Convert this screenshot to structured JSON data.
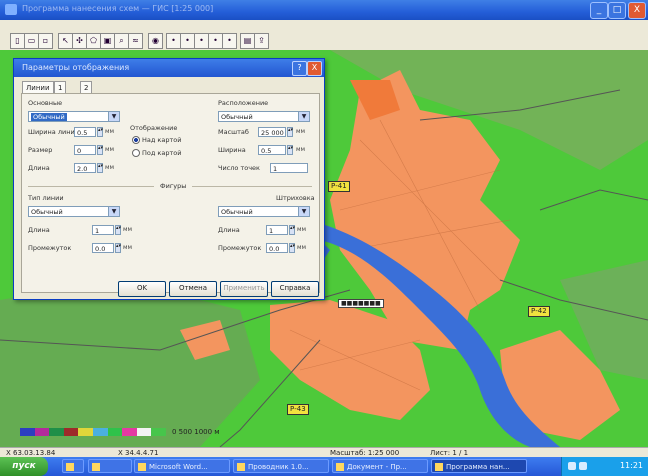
{
  "window": {
    "title": "Программа нанесения схем — ГИС [1:25 000]",
    "buttons": [
      "_",
      "□",
      "X"
    ]
  },
  "toolbar": {
    "tools": [
      "new-file",
      "open-file",
      "save-file",
      "pointer",
      "node-edit",
      "polygon",
      "rectangle",
      "magnify",
      "measure",
      "globe",
      "point1",
      "point2",
      "point3",
      "point4",
      "point5",
      "print",
      "export"
    ],
    "glyphs": [
      "▯",
      "▭",
      "▫",
      "↖",
      "✣",
      "⬠",
      "▣",
      "⌕",
      "≈",
      "◉",
      "•",
      "•",
      "•",
      "•",
      "•",
      "▤",
      "⇪"
    ]
  },
  "dialog": {
    "title": "Параметры отображения",
    "help": "?",
    "close": "X",
    "tabs": [
      "Линии",
      "1",
      "2"
    ],
    "left_group": {
      "header": "Основные",
      "combo_value": "Обычный",
      "fields": [
        {
          "label": "Ширина линии",
          "value": "0.5",
          "unit": "мм"
        },
        {
          "label": "Размер",
          "value": "0",
          "unit": "мм"
        },
        {
          "label": "Длина",
          "value": "2.0",
          "unit": "мм"
        }
      ],
      "options_header": "Отображение",
      "radios": [
        {
          "label": "Над картой",
          "checked": true
        },
        {
          "label": "Под картой",
          "checked": false
        }
      ]
    },
    "right_group": {
      "header": "Расположение",
      "combo_value": "Обычный",
      "fields": [
        {
          "label": "Масштаб",
          "value": "25 000",
          "unit": "мм"
        },
        {
          "label": "Ширина",
          "value": "0.5",
          "unit": "мм"
        },
        {
          "label": "Число точек",
          "value": "1",
          "unit": ""
        }
      ]
    },
    "fill_header": "Фигуры",
    "bottom_left": {
      "header": "Тип линии",
      "combo_value": "Обычный",
      "fields": [
        {
          "label": "Длина",
          "value": "1",
          "unit": "мм"
        },
        {
          "label": "Промежуток",
          "value": "0.0",
          "unit": "мм"
        }
      ]
    },
    "bottom_right": {
      "header": "Штриховка",
      "combo_value": "Обычный",
      "fields": [
        {
          "label": "Длина",
          "value": "1",
          "unit": "мм"
        },
        {
          "label": "Промежуток",
          "value": "0.0",
          "unit": "мм"
        }
      ]
    },
    "buttons": {
      "ok": "OK",
      "cancel": "Отмена",
      "apply": "Применить",
      "help": "Справка"
    }
  },
  "map": {
    "road_labels": [
      "Р-41",
      "Р-42",
      "Р-43"
    ],
    "place_label": "■■■■■■■",
    "scale_colors": [
      "#2c3fbf",
      "#b32a9c",
      "#1f8f48",
      "#9e2a2a",
      "#e0d63a",
      "#4bb0e0",
      "#2fc24a",
      "#e33aa2",
      "#f3f3f3",
      "#47c54b"
    ],
    "scale_caption": "0 500 1000 м"
  },
  "statusbar": {
    "coords": "X 63.03.13.84",
    "mid": "X 34.4.4.71",
    "scale": "Масштаб: 1:25 000",
    "page": "Лист: 1 / 1"
  },
  "taskbar": {
    "start": "пуск",
    "tasks": [
      "",
      "",
      "Microsoft Word...",
      "Проводник 1.0...",
      "Документ - Пр...",
      "Программа нан..."
    ],
    "active_task": 5,
    "clock": "11:21"
  }
}
